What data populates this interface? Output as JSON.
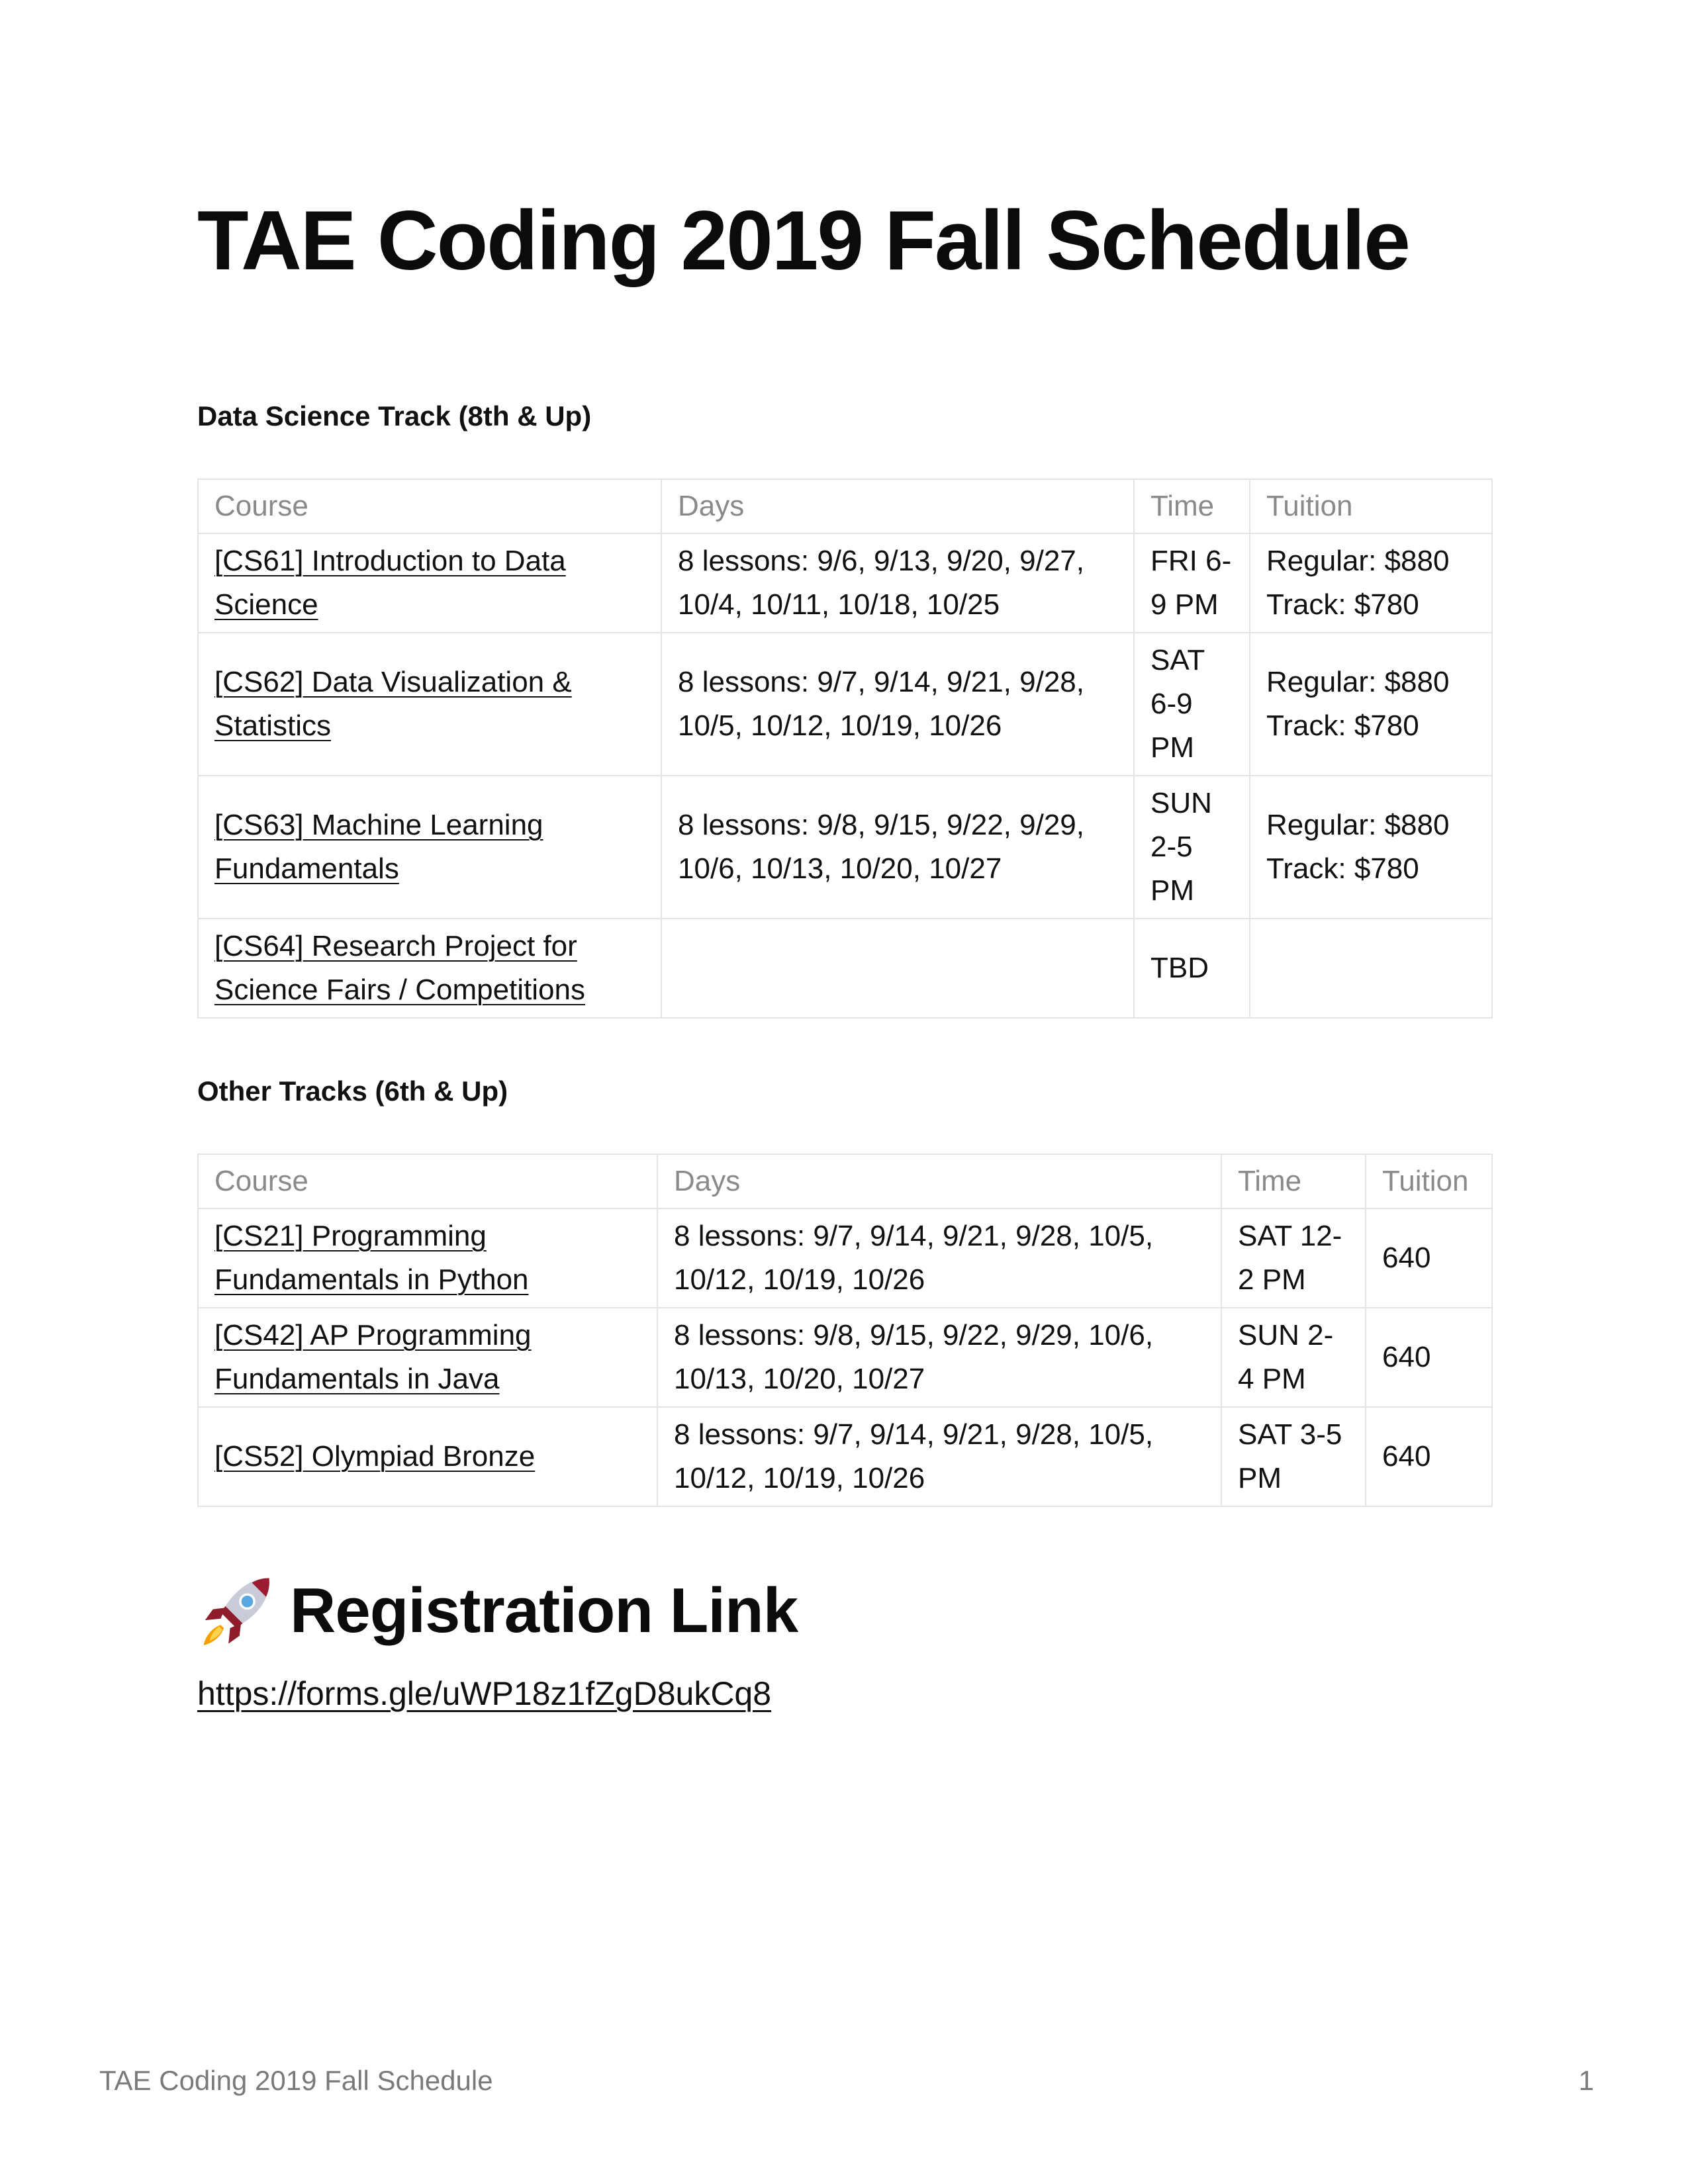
{
  "document": {
    "title": "TAE Coding 2019 Fall Schedule"
  },
  "data_science": {
    "heading": "Data Science Track (8th & Up)",
    "columns": [
      "Course",
      "Days",
      "Time",
      "Tuition"
    ],
    "rows": [
      {
        "course": "[CS61] Introduction to Data Science",
        "days": "8 lessons: 9/6, 9/13, 9/20, 9/27, 10/4, 10/11, 10/18, 10/25",
        "time": "FRI 6-9 PM",
        "tuition_regular": "Regular: $880",
        "tuition_track": "Track: $780"
      },
      {
        "course": "[CS62] Data Visualization & Statistics",
        "days": "8 lessons: 9/7, 9/14, 9/21, 9/28, 10/5, 10/12, 10/19, 10/26",
        "time": "SAT 6-9 PM",
        "tuition_regular": "Regular: $880",
        "tuition_track": "Track: $780"
      },
      {
        "course": "[CS63] Machine Learning Fundamentals",
        "days": "8 lessons: 9/8, 9/15, 9/22, 9/29, 10/6, 10/13, 10/20, 10/27",
        "time": "SUN 2-5 PM",
        "tuition_regular": "Regular: $880",
        "tuition_track": "Track: $780"
      },
      {
        "course": "[CS64] Research Project for Science Fairs / Competitions",
        "days": "",
        "time": "TBD",
        "tuition_regular": "",
        "tuition_track": ""
      }
    ]
  },
  "other_tracks": {
    "heading": "Other Tracks (6th & Up)",
    "columns": [
      "Course",
      "Days",
      "Time",
      "Tuition"
    ],
    "rows": [
      {
        "course": "[CS21] Programming Fundamentals in Python",
        "days": "8 lessons: 9/7, 9/14, 9/21, 9/28, 10/5, 10/12, 10/19, 10/26",
        "time": "SAT 12-2 PM",
        "tuition": "640"
      },
      {
        "course": "[CS42] AP Programming Fundamentals in Java",
        "days": "8 lessons: 9/8, 9/15, 9/22, 9/29, 10/6, 10/13, 10/20, 10/27",
        "time": "SUN 2-4 PM",
        "tuition": "640"
      },
      {
        "course": "[CS52] Olympiad Bronze",
        "days": "8 lessons: 9/7, 9/14, 9/21, 9/28, 10/5, 10/12, 10/19, 10/26",
        "time": "SAT 3-5 PM",
        "tuition": "640"
      }
    ]
  },
  "registration": {
    "icon": "rocket-icon",
    "heading": "Registration Link",
    "link": "https://forms.gle/uWP18z1fZgD8ukCq8"
  },
  "footer": {
    "title": "TAE Coding 2019 Fall Schedule",
    "page_number": "1"
  }
}
